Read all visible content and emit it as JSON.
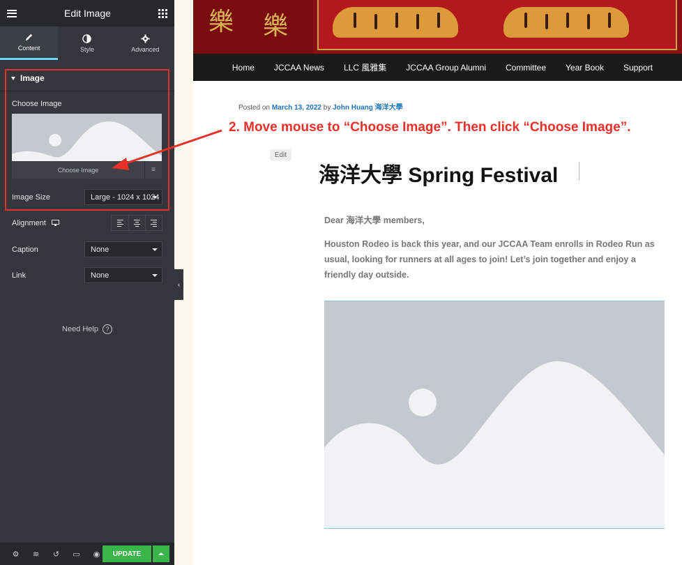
{
  "panel": {
    "title": "Edit Image",
    "tabs": [
      {
        "label": "Content",
        "icon": "pencil-icon",
        "active": true
      },
      {
        "label": "Style",
        "icon": "contrast-icon",
        "active": false
      },
      {
        "label": "Advanced",
        "icon": "gear-icon",
        "active": false
      }
    ],
    "section_title": "Image",
    "choose_image_label": "Choose Image",
    "choose_image_button": "Choose Image",
    "image_size_label": "Image Size",
    "image_size_value": "Large - 1024 x 1024",
    "alignment_label": "Alignment",
    "caption_label": "Caption",
    "caption_value": "None",
    "link_label": "Link",
    "link_value": "None",
    "need_help": "Need Help",
    "update_label": "UPDATE",
    "accent_color": "#71d7f7",
    "update_color": "#39b54a"
  },
  "site": {
    "banner_chars": [
      "樂",
      "樂"
    ],
    "nav": [
      "Home",
      "JCCAA News",
      "LLC 風雅集",
      "JCCAA Group Alumni",
      "Committee",
      "Year Book",
      "Support"
    ],
    "posted_prefix": "Posted on",
    "posted_date": "March 13, 2022",
    "posted_by": "by",
    "author": "John Huang 海洋大學",
    "edit_label": "Edit",
    "post_title": "海洋大學 Spring Festival",
    "greeting": "Dear 海洋大學 members,",
    "paragraph": "Houston Rodeo is back this year, and our JCCAA Team enrolls in Rodeo Run as usual, looking for runners at all ages to join! Let’s join together and enjoy a friendly day outside.",
    "link_color": "#1e73be"
  },
  "annotation": {
    "text": "2. Move mouse to “Choose Image”. Then click “Choose Image”.",
    "color": "#e8302a"
  }
}
